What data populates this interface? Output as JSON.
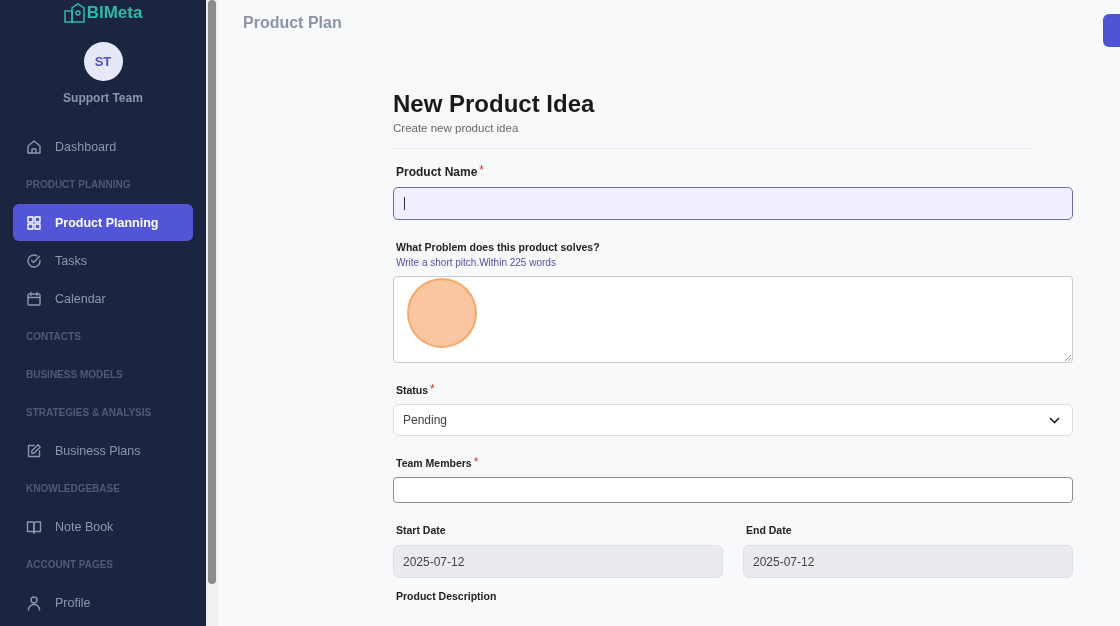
{
  "sidebar": {
    "logo": "BIMeta",
    "user": {
      "initials": "ST",
      "name": "Support Team"
    },
    "items": [
      {
        "kind": "link",
        "label": "Dashboard",
        "selected": false
      },
      {
        "kind": "section",
        "label": "PRODUCT PLANNING"
      },
      {
        "kind": "link",
        "label": "Product Planning",
        "selected": true
      },
      {
        "kind": "link",
        "label": "Tasks",
        "selected": false
      },
      {
        "kind": "link",
        "label": "Calendar",
        "selected": false
      },
      {
        "kind": "section",
        "label": "CONTACTS"
      },
      {
        "kind": "section",
        "label": "BUSINESS MODELS"
      },
      {
        "kind": "section",
        "label": "STRATEGIES & ANALYSIS"
      },
      {
        "kind": "link",
        "label": "Business Plans",
        "selected": false
      },
      {
        "kind": "section",
        "label": "KNOWLEDGEBASE"
      },
      {
        "kind": "link",
        "label": "Note Book",
        "selected": false
      },
      {
        "kind": "section",
        "label": "ACCOUNT PAGES"
      },
      {
        "kind": "link",
        "label": "Profile",
        "selected": false
      }
    ]
  },
  "page_title": "Product Plan",
  "form": {
    "title": "New Product Idea",
    "subtitle": "Create new product idea",
    "fields": [
      {
        "kind": "input",
        "label": "Product Name",
        "required_mark": "*",
        "focused": true,
        "disabled": false
      },
      {
        "kind": "textarea",
        "label": "What Problem does this product solves?",
        "hint": "Write a short pitch.Within 225 words",
        "focused": false,
        "disabled": false
      },
      {
        "kind": "select",
        "label": "Status",
        "required_mark": "*",
        "value": "Pending",
        "focused": false,
        "disabled": false
      },
      {
        "kind": "input",
        "label": "Team Members",
        "required_mark": "*",
        "focused": false,
        "disabled": false
      }
    ],
    "dates": [
      {
        "label": "Start Date",
        "value": "2025-07-12",
        "disabled": true
      },
      {
        "label": "End Date",
        "value": "2025-07-12",
        "disabled": true
      }
    ],
    "next_label": "Product Description"
  }
}
